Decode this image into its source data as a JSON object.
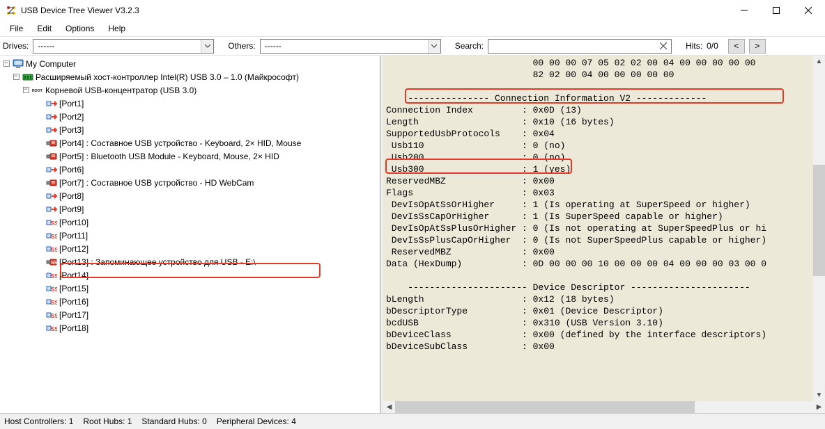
{
  "window": {
    "title": "USB Device Tree Viewer V3.2.3"
  },
  "menu": {
    "items": [
      "File",
      "Edit",
      "Options",
      "Help"
    ]
  },
  "toolbar": {
    "drives_label": "Drives:",
    "drives_value": "------",
    "others_label": "Others:",
    "others_value": "------",
    "search_label": "Search:",
    "search_value": "",
    "hits_label": "Hits:",
    "hits_value": "0/0",
    "prev_label": "<",
    "next_label": ">"
  },
  "tree": {
    "root": "My Computer",
    "controller": "Расширяемый хост-контроллер Intel(R) USB 3.0 – 1.0 (Майкрософт)",
    "hub": "Корневой USB-концентратор (USB 3.0)",
    "ports": [
      "[Port1]",
      "[Port2]",
      "[Port3]",
      "[Port4] : Составное USB устройство - Keyboard, 2× HID, Mouse",
      "[Port5] : Bluetooth USB Module - Keyboard, Mouse, 2× HID",
      "[Port6]",
      "[Port7] : Составное USB устройство - HD WebCam",
      "[Port8]",
      "[Port9]",
      "[Port10]",
      "[Port11]",
      "[Port12]",
      "[Port13] : Запоминающее устройство для USB - E:\\",
      "[Port14]",
      "[Port15]",
      "[Port16]",
      "[Port17]",
      "[Port18]"
    ]
  },
  "details": {
    "lines": [
      "                           00 00 00 07 05 02 02 00 04 00 00 00 00 00",
      "                           82 02 00 04 00 00 00 00 00",
      "",
      "    --------------- Connection Information V2 -------------",
      "Connection Index         : 0x0D (13)",
      "Length                   : 0x10 (16 bytes)",
      "SupportedUsbProtocols    : 0x04",
      " Usb110                  : 0 (no)",
      " Usb200                  : 0 (no)",
      " Usb300                  : 1 (yes)",
      "ReservedMBZ              : 0x00",
      "Flags                    : 0x03",
      " DevIsOpAtSsOrHigher     : 1 (Is operating at SuperSpeed or higher)",
      " DevIsSsCapOrHigher      : 1 (Is SuperSpeed capable or higher)",
      " DevIsOpAtSsPlusOrHigher : 0 (Is not operating at SuperSpeedPlus or hi",
      " DevIsSsPlusCapOrHigher  : 0 (Is not SuperSpeedPlus capable or higher)",
      " ReservedMBZ             : 0x00",
      "Data (HexDump)           : 0D 00 00 00 10 00 00 00 04 00 00 00 03 00 0",
      "",
      "    ---------------------- Device Descriptor ----------------------",
      "bLength                  : 0x12 (18 bytes)",
      "bDescriptorType          : 0x01 (Device Descriptor)",
      "bcdUSB                   : 0x310 (USB Version 3.10)",
      "bDeviceClass             : 0x00 (defined by the interface descriptors)",
      "bDeviceSubClass          : 0x00"
    ]
  },
  "status": {
    "host_controllers": "Host Controllers: 1",
    "root_hubs": "Root Hubs: 1",
    "standard_hubs": "Standard Hubs: 0",
    "peripheral_devices": "Peripheral Devices: 4"
  }
}
